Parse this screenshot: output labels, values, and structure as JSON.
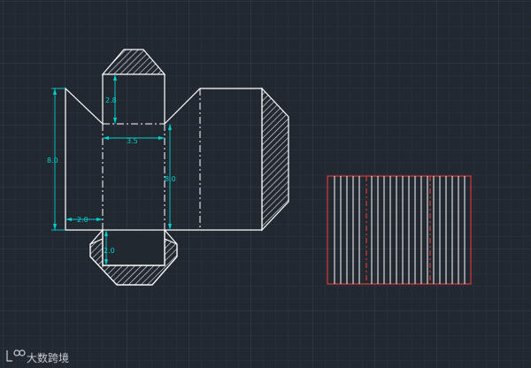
{
  "dimensions": {
    "height_overall": "8.0",
    "top_flap_height": "2.8",
    "width_center": "3.5",
    "height_right": "8.0",
    "width_left": "2.0",
    "bottom_flap_height": "2.0"
  },
  "watermark": {
    "text": "大数跨境"
  },
  "colors": {
    "background": "#212830",
    "grid_minor": "#2b3340",
    "grid_major": "#36404e",
    "outline": "#ffffff",
    "dimension": "#00d0d0",
    "preview_border": "#ff3a3a",
    "preview_fold": "#ff3a3a"
  }
}
